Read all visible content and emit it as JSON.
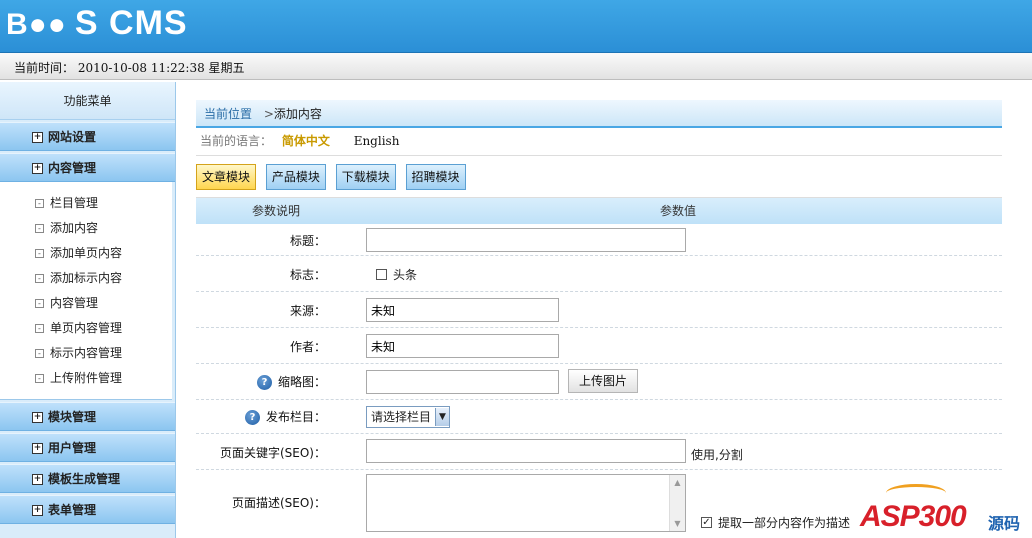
{
  "header": {
    "logo_b": "B",
    "logo_rest": "S CMS"
  },
  "timebar": {
    "label": "当前时间：",
    "value": "2010-10-08 11:22:38 星期五"
  },
  "sidebar": {
    "title": "功能菜单",
    "groups_top": [
      {
        "label": "网站设置"
      },
      {
        "label": "内容管理"
      }
    ],
    "sub_items": [
      "栏目管理",
      "添加内容",
      "添加单页内容",
      "添加标示内容",
      "内容管理",
      "单页内容管理",
      "标示内容管理",
      "上传附件管理"
    ],
    "groups_bottom": [
      {
        "label": "模块管理"
      },
      {
        "label": "用户管理"
      },
      {
        "label": "模板生成管理"
      },
      {
        "label": "表单管理"
      }
    ]
  },
  "breadcrumb": {
    "prefix": "当前位置",
    "sep": ">",
    "current": "添加内容"
  },
  "languages": {
    "label": "当前的语言：",
    "zh": "简体中文",
    "en": "English"
  },
  "tabs": [
    "文章模块",
    "产品模块",
    "下载模块",
    "招聘模块"
  ],
  "table_header": {
    "param": "参数说明",
    "value": "参数值"
  },
  "form": {
    "title_label": "标题：",
    "flag_label": "标志：",
    "flag_option": "头条",
    "source_label": "来源：",
    "source_value": "未知",
    "author_label": "作者：",
    "author_value": "未知",
    "thumb_label": "缩略图：",
    "upload_btn": "上传图片",
    "category_label": "发布栏目：",
    "category_value": "请选择栏目",
    "keywords_label": "页面关键字(SEO)：",
    "keywords_hint": "使用,分割",
    "desc_label": "页面描述(SEO)：",
    "desc_hint": "提取一部分内容作为描述"
  },
  "watermark": {
    "text": "ASP300",
    "suffix": "源码"
  },
  "colors": {
    "header": "#2b8fd6",
    "active_tab": "#ffd64f",
    "lang_active": "#c99a00"
  }
}
